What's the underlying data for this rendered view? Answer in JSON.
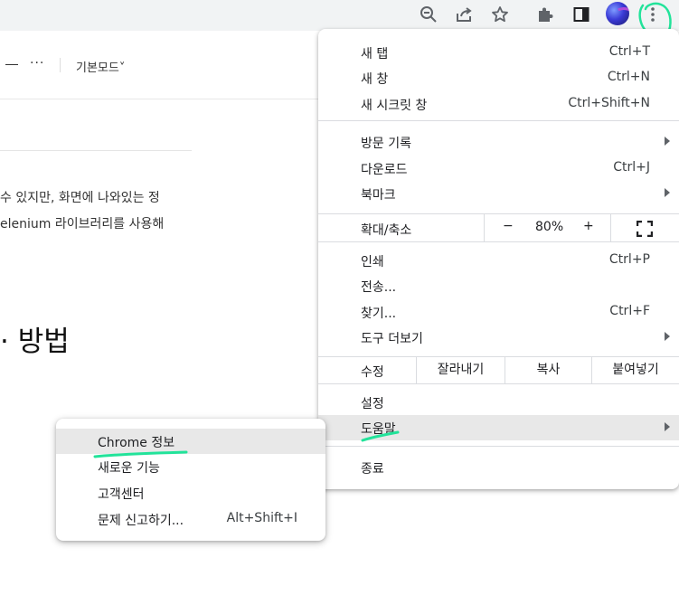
{
  "toolbar": {
    "icons": [
      "zoom-out-icon",
      "share-icon",
      "bookmark-star-icon",
      "extensions-puzzle-icon",
      "side-panel-icon",
      "profile-avatar",
      "kebab-menu-icon"
    ]
  },
  "page": {
    "header_mode": "기본모드˅",
    "para1": "수 있지만, 화면에 나와있는 정",
    "para2": "elenium 라이브러리를 사용해",
    "heading": "· 방법"
  },
  "menu": {
    "new_tab": {
      "label": "새 탭",
      "shortcut": "Ctrl+T"
    },
    "new_window": {
      "label": "새 창",
      "shortcut": "Ctrl+N"
    },
    "incognito": {
      "label": "새 시크릿 창",
      "shortcut": "Ctrl+Shift+N"
    },
    "history": {
      "label": "방문 기록"
    },
    "downloads": {
      "label": "다운로드",
      "shortcut": "Ctrl+J"
    },
    "bookmarks": {
      "label": "북마크"
    },
    "zoom": {
      "label": "확대/축소",
      "minus": "−",
      "value": "80%",
      "plus": "+"
    },
    "print": {
      "label": "인쇄",
      "shortcut": "Ctrl+P"
    },
    "cast": {
      "label": "전송..."
    },
    "find": {
      "label": "찾기...",
      "shortcut": "Ctrl+F"
    },
    "more_tools": {
      "label": "도구 더보기"
    },
    "edit": {
      "label": "수정",
      "cut": "잘라내기",
      "copy": "복사",
      "paste": "붙여넣기"
    },
    "settings": {
      "label": "설정"
    },
    "help": {
      "label": "도움말"
    },
    "exit": {
      "label": "종료"
    }
  },
  "help_submenu": {
    "about": {
      "label": "Chrome 정보"
    },
    "whats_new": {
      "label": "새로운 기능"
    },
    "help_center": {
      "label": "고객센터"
    },
    "report": {
      "label": "문제 신고하기...",
      "shortcut": "Alt+Shift+I"
    }
  },
  "colors": {
    "annotation": "#22e39a",
    "highlight_bg": "#e8e8e8",
    "toolbar_bg": "#f1f3f4"
  }
}
